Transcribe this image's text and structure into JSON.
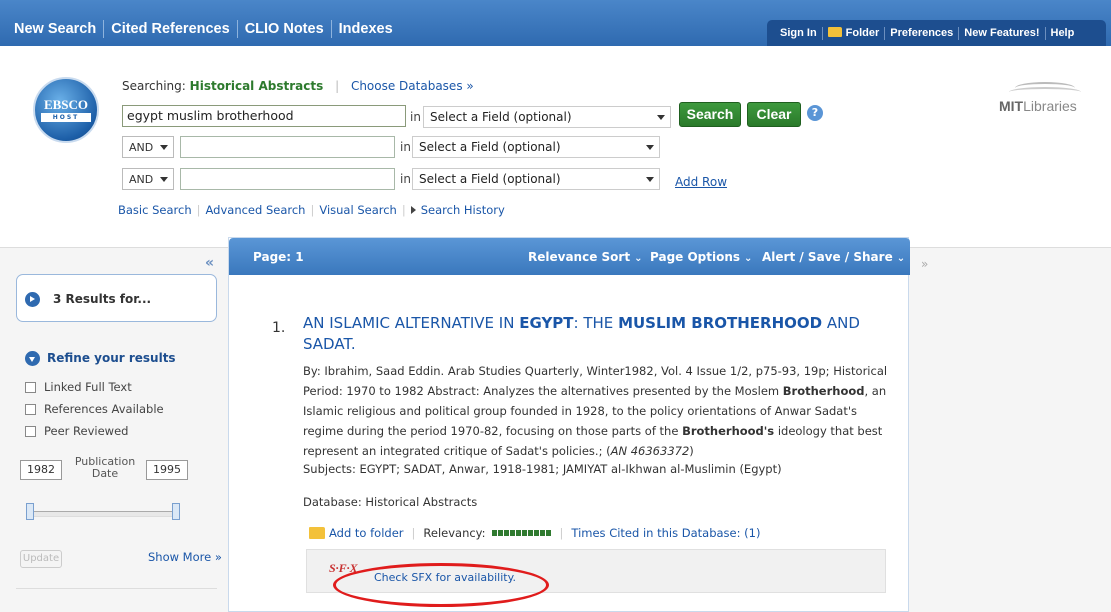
{
  "topnav": {
    "items": [
      "New Search",
      "Cited References",
      "CLIO Notes",
      "Indexes"
    ]
  },
  "utilnav": {
    "items": [
      "Sign In",
      "Folder",
      "Preferences",
      "New Features!",
      "Help"
    ]
  },
  "logo": {
    "line1": "EBSCO",
    "line2": "HOST"
  },
  "search": {
    "searching_label": "Searching:",
    "database": "Historical Abstracts",
    "choose_db": "Choose Databases »",
    "rows": [
      {
        "bool": "",
        "value": "egypt muslim brotherhood",
        "field": "Select a Field (optional)"
      },
      {
        "bool": "AND",
        "value": "",
        "field": "Select a Field (optional)"
      },
      {
        "bool": "AND",
        "value": "",
        "field": "Select a Field (optional)"
      }
    ],
    "in_label": "in",
    "search_button": "Search",
    "clear_button": "Clear",
    "help": "?",
    "add_row": "Add Row",
    "links": [
      "Basic Search",
      "Advanced Search",
      "Visual Search",
      "Search History"
    ]
  },
  "mit": {
    "bold": "MIT",
    "rest": "Libraries"
  },
  "left": {
    "collapse": "«",
    "results_count": "3 Results for...",
    "refine": "Refine your results",
    "filters": [
      "Linked Full Text",
      "References Available",
      "Peer Reviewed"
    ],
    "year_from": "1982",
    "year_to": "1995",
    "pub_label_1": "Publication",
    "pub_label_2": "Date",
    "update": "Update",
    "show_more": "Show More »"
  },
  "results": {
    "page": "Page: 1",
    "menus": [
      "Relevance Sort",
      "Page Options",
      "Alert / Save / Share"
    ],
    "right_collapse": "»",
    "items": [
      {
        "number": "1.",
        "title_parts": [
          "AN ISLAMIC ALTERNATIVE IN ",
          "EGYPT",
          ": THE ",
          "MUSLIM BROTHERHOOD",
          " AND SADAT."
        ],
        "body_1": "By: Ibrahim, Saad Eddin. Arab Studies Quarterly, Winter1982, Vol. 4 Issue 1/2, p75-93, 19p; Historical Period: 1970 to 1982 Abstract: Analyzes the alternatives presented by the Moslem ",
        "body_b1": "Brotherhood",
        "body_2": ", an Islamic religious and political group founded in 1928, to the policy orientations of Anwar Sadat's regime during the period 1970-82, focusing on those parts of the ",
        "body_b2": "Brotherhood's",
        "body_3": " ideology that best represent an integrated critique of Sadat's policies.; (",
        "an": "AN 46363372",
        "body_4": ")",
        "subjects": "Subjects: EGYPT; SADAT, Anwar, 1918-1981; JAMIYAT al-Ikhwan al-Muslimin (Egypt)",
        "database": "Database: Historical Abstracts",
        "add_folder": "Add to folder",
        "relevancy": "Relevancy:",
        "relevancy_level": 1.0,
        "times_cited": "Times Cited in this Database: (1)",
        "sfx_logo": "S·F·X",
        "sfx_link": "Check SFX for availability."
      }
    ]
  },
  "colors": {
    "topbar": "#2f6ab0",
    "green": "#2a7a2a",
    "link": "#1a56a8",
    "highlight": "#e01c1c"
  }
}
